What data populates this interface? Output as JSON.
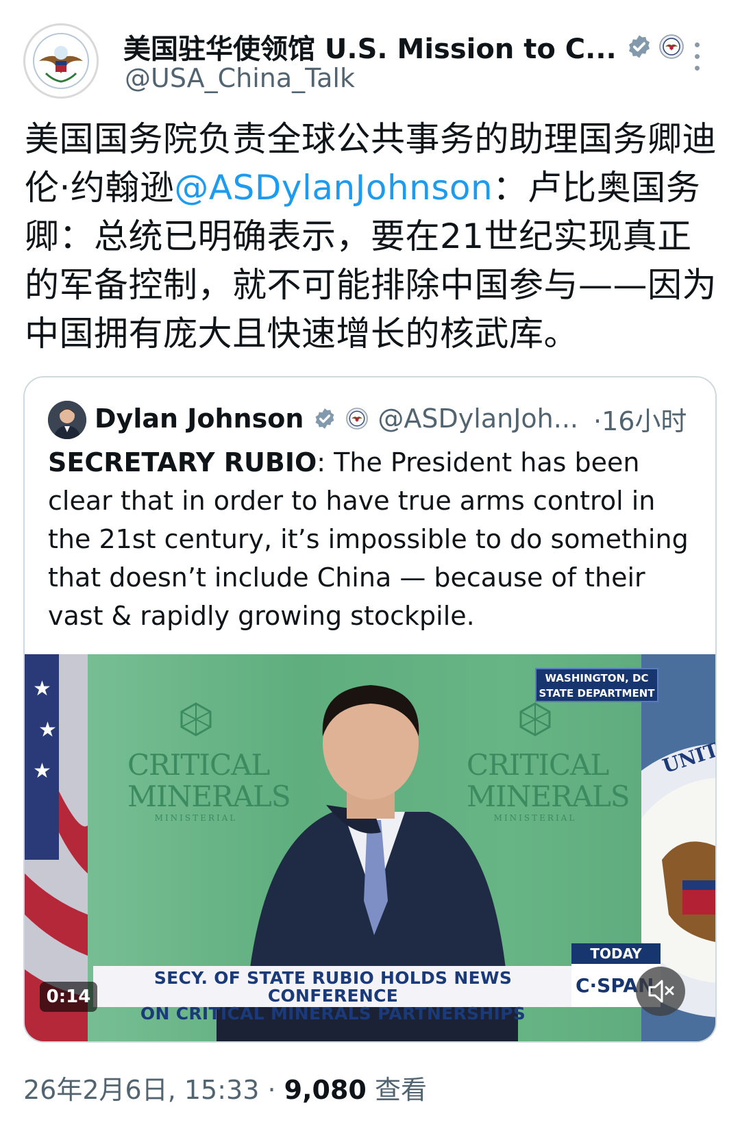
{
  "post": {
    "display_name": "美国驻华使领馆 U.S. Mission to C...",
    "handle": "@USA_China_Talk",
    "text_before": "美国国务院负责全球公共事务的助理国务卿迪伦·约翰逊",
    "mention": "@ASDylanJohnson",
    "text_after": "：卢比奥国务卿：总统已明确表示，要在21世纪实现真正的军备控制，就不可能排除中国参与——因为中国拥有庞大且快速增长的核武库。",
    "timestamp": "26年2月6日, 15:33",
    "separator": " · ",
    "views_count": "9,080",
    "views_label": "查看"
  },
  "quote": {
    "name": "Dylan Johnson",
    "handle": "@ASDylanJoh...",
    "time": "·16小时",
    "bold_prefix": "SECRETARY RUBIO",
    "text": ": The President has been clear that in order to have true arms control in the 21st century, it’s impossible to do something that doesn’t include China — because of their vast & rapidly growing stockpile."
  },
  "video": {
    "location_line1": "WASHINGTON, DC",
    "location_line2": "STATE DEPARTMENT",
    "backdrop_logo_line1": "CRITICAL",
    "backdrop_logo_line2": "MINERALS",
    "backdrop_logo_sub": "MINISTERIAL",
    "seal_text": "UNIT",
    "chyron_line1": "SECY. OF STATE RUBIO HOLDS NEWS CONFERENCE",
    "chyron_line2": "ON CRITICAL MINERALS PARTNERSHIPS",
    "today_label": "TODAY",
    "network": "C·SPAN",
    "duration": "0:14"
  },
  "icons": {
    "verified": "verified-badge-icon",
    "seal": "government-seal-icon",
    "more": "more-vertical-icon",
    "mute": "muted-speaker-icon"
  },
  "colors": {
    "link": "#1d9bf0",
    "secondary_text": "#536471",
    "badge": "#829aab"
  }
}
